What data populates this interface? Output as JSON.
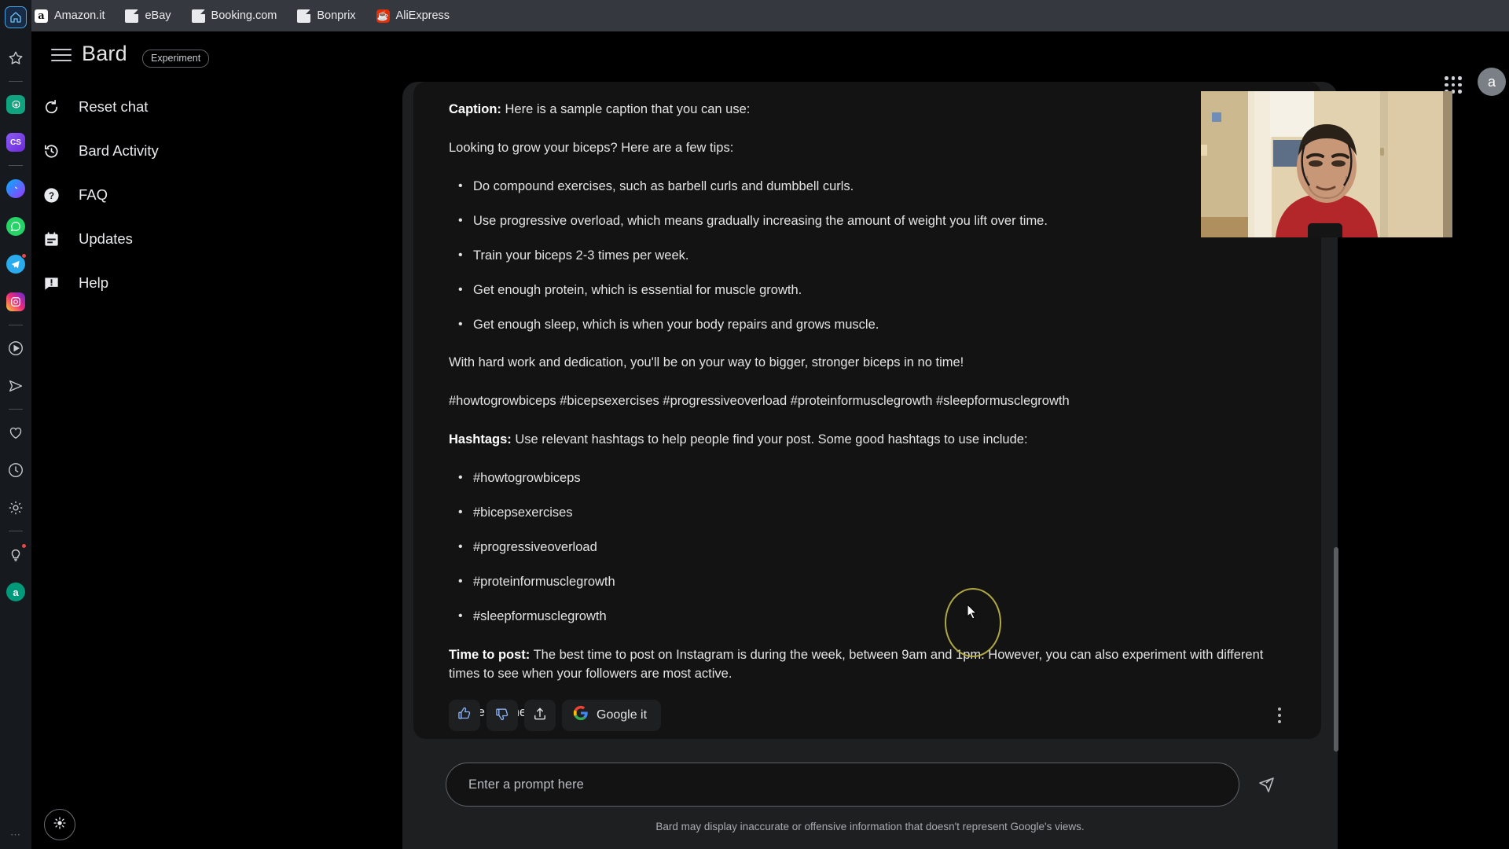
{
  "browser": {
    "bookmarks": [
      {
        "label": "Amazon.it",
        "icon": "amazon-favicon"
      },
      {
        "label": "eBay",
        "icon": "page-favicon"
      },
      {
        "label": "Booking.com",
        "icon": "page-favicon"
      },
      {
        "label": "Bonprix",
        "icon": "page-favicon"
      },
      {
        "label": "AliExpress",
        "icon": "aliexpress-favicon"
      }
    ]
  },
  "rail": {
    "home_icon": "home-icon",
    "items": [
      {
        "icon": "star-icon",
        "name": "star"
      },
      {
        "icon": "openai-icon",
        "name": "chatgpt",
        "color": "#10a37f"
      },
      {
        "icon": "cs-icon",
        "name": "cs",
        "color": "#7c3aed"
      },
      {
        "icon": "messenger-icon",
        "name": "messenger",
        "color": "#a033ff"
      },
      {
        "icon": "whatsapp-icon",
        "name": "whatsapp",
        "color": "#25d366"
      },
      {
        "icon": "telegram-icon",
        "name": "telegram",
        "color": "#2aabee",
        "badge": true
      },
      {
        "icon": "instagram-icon",
        "name": "instagram",
        "color": "#e1306c"
      },
      {
        "icon": "play-circle-icon",
        "name": "media"
      },
      {
        "icon": "send-icon",
        "name": "send"
      },
      {
        "icon": "heart-icon",
        "name": "favorites"
      },
      {
        "icon": "clock-icon",
        "name": "history"
      },
      {
        "icon": "gear-icon",
        "name": "settings"
      },
      {
        "icon": "lightbulb-icon",
        "name": "tips",
        "badge": true
      },
      {
        "icon": "a-avatar-icon",
        "name": "account",
        "color": "#00997a",
        "letter": "a"
      }
    ]
  },
  "header": {
    "title": "Bard",
    "badge": "Experiment",
    "menu_icon": "hamburger-icon",
    "apps_icon": "apps-grid-icon",
    "avatar_letter": "a"
  },
  "sidebar": {
    "items": [
      {
        "label": "Reset chat",
        "icon": "reset-icon"
      },
      {
        "label": "Bard Activity",
        "icon": "history-icon"
      },
      {
        "label": "FAQ",
        "icon": "question-mark-icon"
      },
      {
        "label": "Updates",
        "icon": "calendar-icon"
      },
      {
        "label": "Help",
        "icon": "help-bubble-icon"
      }
    ],
    "theme_toggle_icon": "sun-icon"
  },
  "response": {
    "caption_label": "Caption:",
    "caption_text": " Here is a sample caption that you can use:",
    "intro": "Looking to grow your biceps? Here are a few tips:",
    "tips": [
      "Do compound exercises, such as barbell curls and dumbbell curls.",
      "Use progressive overload, which means gradually increasing the amount of weight you lift over time.",
      "Train your biceps 2-3 times per week.",
      "Get enough protein, which is essential for muscle growth.",
      "Get enough sleep, which is when your body repairs and grows muscle."
    ],
    "closing": "With hard work and dedication, you'll be on your way to bigger, stronger biceps in no time!",
    "hashtag_line": "#howtogrowbiceps #bicepsexercises #progressiveoverload #proteinformusclegrowth #sleepformusclegrowth",
    "hashtags_label": "Hashtags:",
    "hashtags_text": " Use relevant hashtags to help people find your post. Some good hashtags to use include:",
    "hashtags": [
      "#howtogrowbiceps",
      "#bicepsexercises",
      "#progressiveoverload",
      "#proteinformusclegrowth",
      "#sleepformusclegrowth"
    ],
    "time_label": "Time to post:",
    "time_text": " The best time to post on Instagram is during the week, between 9am and 1pm. However, you can also experiment with different times to see when your followers are most active.",
    "signoff": "I hope this helps!"
  },
  "actions": {
    "thumbs_up_icon": "thumbs-up-icon",
    "thumbs_down_icon": "thumbs-down-icon",
    "share_icon": "share-upload-icon",
    "google_it_label": "Google it",
    "google_logo": "G",
    "more_icon": "more-vertical-icon"
  },
  "prompt": {
    "placeholder": "Enter a prompt here",
    "value": "",
    "send_icon": "send-icon"
  },
  "footer": {
    "disclaimer": "Bard may display inaccurate or offensive information that doesn't represent Google's views."
  },
  "webcam": {
    "name": "webcam-overlay"
  },
  "colors": {
    "accent_blue": "#8ab4f8",
    "bookmark_bar": "#35393f",
    "panel": "#1e1f20",
    "card": "#131314"
  }
}
